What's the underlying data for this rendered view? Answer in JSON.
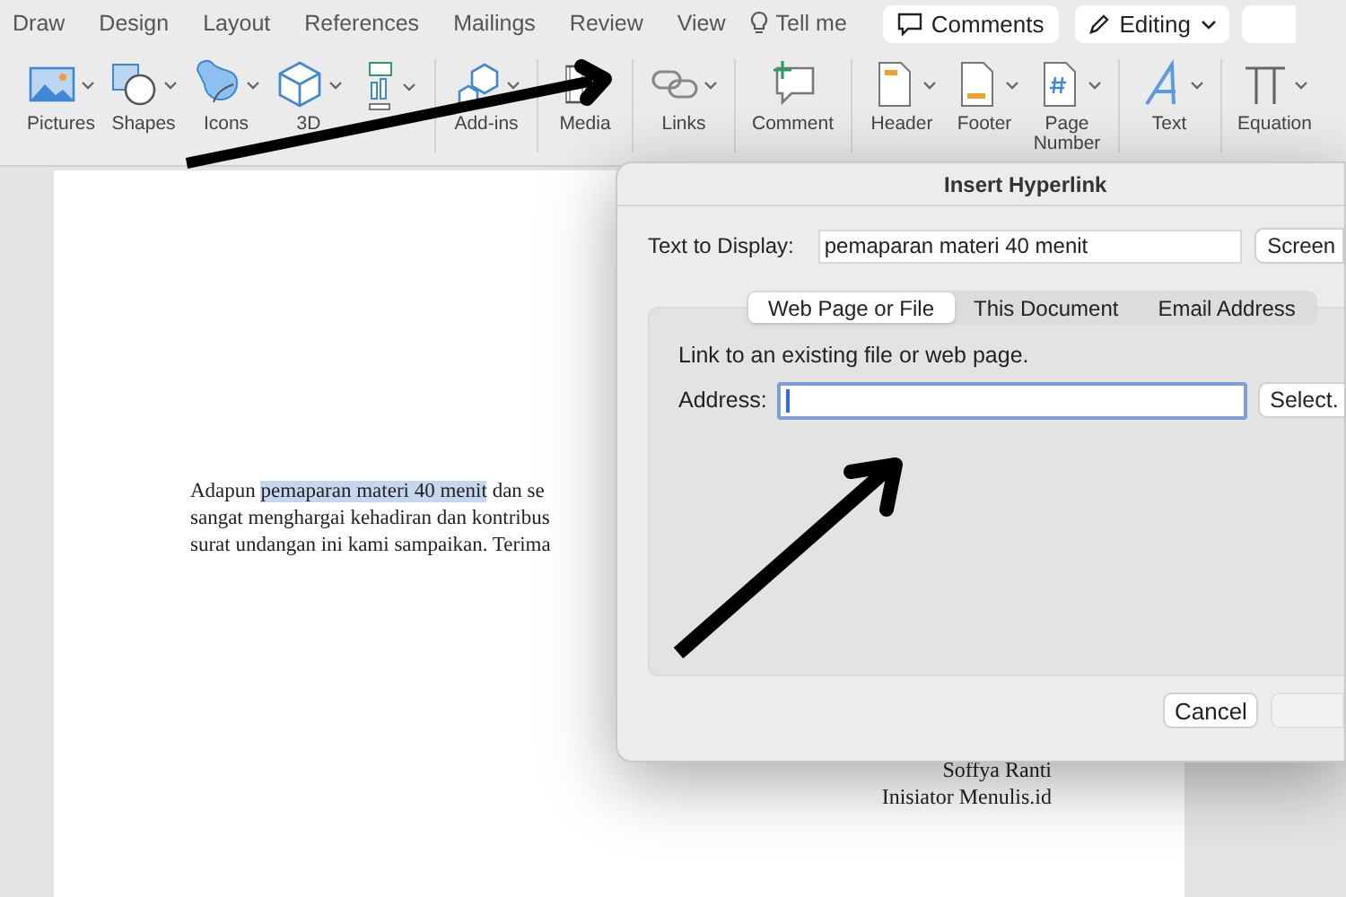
{
  "ribbon_tabs": [
    {
      "label": "Draw"
    },
    {
      "label": "Design"
    },
    {
      "label": "Layout"
    },
    {
      "label": "References"
    },
    {
      "label": "Mailings"
    },
    {
      "label": "Review"
    },
    {
      "label": "View"
    }
  ],
  "tell_me": "Tell me",
  "comments_button": "Comments",
  "editing_button": "Editing",
  "ribbon_groups": [
    [
      {
        "kind": "pictures",
        "label": "Pictures"
      },
      {
        "kind": "shapes",
        "label": "Shapes"
      },
      {
        "kind": "icons",
        "label": "Icons"
      },
      {
        "kind": "cube",
        "label": "3D"
      },
      {
        "kind": "stack"
      }
    ],
    [
      {
        "kind": "addins",
        "label": "Add-ins"
      }
    ],
    [
      {
        "kind": "media",
        "label": "Media"
      }
    ],
    [
      {
        "kind": "links",
        "label": "Links"
      }
    ],
    [
      {
        "kind": "comment",
        "label": "Comment"
      }
    ],
    [
      {
        "kind": "header",
        "label": "Header"
      },
      {
        "kind": "footer",
        "label": "Footer"
      },
      {
        "kind": "pagenum",
        "label": "Page\nNumber"
      }
    ],
    [
      {
        "kind": "text",
        "label": "Text"
      }
    ],
    [
      {
        "kind": "equation",
        "label": "Equation"
      }
    ]
  ],
  "paragraph_lines": [
    [
      {
        "text": "Adapun ",
        "selected": false
      },
      {
        "text": "pemaparan materi 40 menit",
        "selected": true
      },
      {
        "text": " dan se",
        "selected": false
      }
    ],
    [
      {
        "text": "sangat menghargai kehadiran dan kontribus",
        "selected": false
      }
    ],
    [
      {
        "text": "surat undangan ini kami sampaikan. Terima",
        "selected": false
      }
    ]
  ],
  "signature": [
    "Soffya Ranti",
    "Inisiator Menulis.id"
  ],
  "dialog": {
    "title": "Insert Hyperlink",
    "text_to_display_label": "Text to Display:",
    "text_to_display": "pemaparan materi 40 menit",
    "screentip_button": "Screen",
    "tabs": [
      {
        "label": "Web Page or File",
        "selected": true
      },
      {
        "label": "This Document",
        "selected": false
      },
      {
        "label": "Email Address",
        "selected": false
      }
    ],
    "hint": "Link to an existing file or web page.",
    "address_label": "Address:",
    "select_button": "Select.",
    "cancel_button": "Cancel"
  }
}
